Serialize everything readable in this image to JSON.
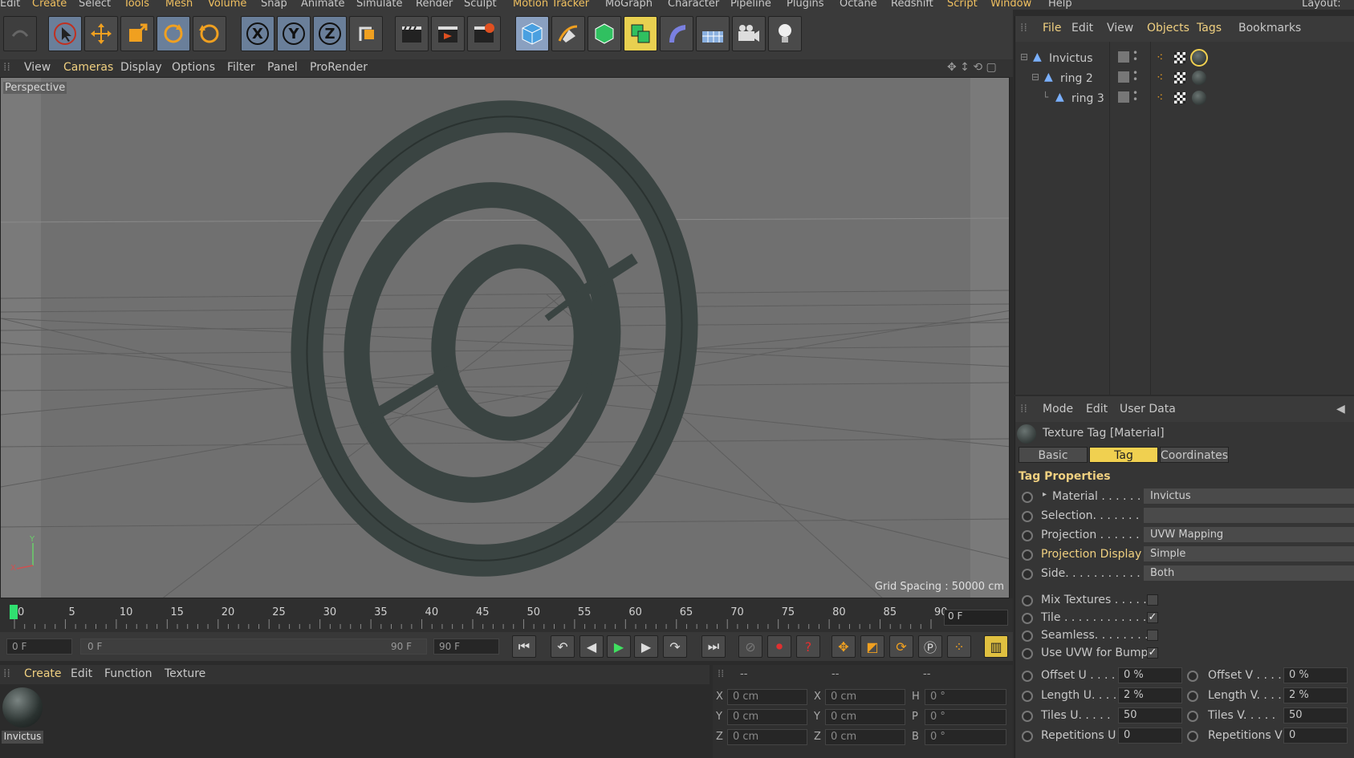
{
  "menubar": {
    "items": [
      "Edit",
      "Create",
      "Select",
      "Tools",
      "Mesh",
      "Volume",
      "Snap",
      "Animate",
      "Simulate",
      "Render",
      "Sculpt",
      "Motion Tracker",
      "MoGraph",
      "Character",
      "Pipeline",
      "Plugins",
      "Octane",
      "Redshift",
      "Script",
      "Window",
      "Help"
    ],
    "layout_label": "Layout:"
  },
  "viewport": {
    "menu": [
      "View",
      "Cameras",
      "Display",
      "Options",
      "Filter",
      "Panel",
      "ProRender"
    ],
    "camera_label": "Perspective",
    "grid_spacing": "Grid Spacing : 50000 cm",
    "bg_color": "#6e6e6e",
    "ring_color": "#3a4442"
  },
  "timeline": {
    "ticks": [
      "0",
      "5",
      "10",
      "15",
      "20",
      "25",
      "30",
      "35",
      "40",
      "45",
      "50",
      "55",
      "60",
      "65",
      "70",
      "75",
      "80",
      "85",
      "90"
    ],
    "end_frame": "0 F",
    "current_frame": 0
  },
  "transport": {
    "start_field": "0 F",
    "range_start": "0 F",
    "range_end": "90 F",
    "end_field": "90 F"
  },
  "material_manager": {
    "menu": [
      "Create",
      "Edit",
      "Function",
      "Texture"
    ],
    "materials": [
      {
        "name": "Invictus"
      }
    ]
  },
  "coordinates": {
    "header": [
      "--",
      "--",
      "--"
    ],
    "rows": [
      {
        "axis": "X",
        "pos": "0 cm",
        "axis2": "X",
        "size": "0 cm",
        "rot_label": "H",
        "rot": "0 °"
      },
      {
        "axis": "Y",
        "pos": "0 cm",
        "axis2": "Y",
        "size": "0 cm",
        "rot_label": "P",
        "rot": "0 °"
      },
      {
        "axis": "Z",
        "pos": "0 cm",
        "axis2": "Z",
        "size": "0 cm",
        "rot_label": "B",
        "rot": "0 °"
      }
    ]
  },
  "object_manager": {
    "menu": [
      "File",
      "Edit",
      "View",
      "Objects",
      "Tags",
      "Bookmarks"
    ],
    "objects": [
      {
        "name": "Invictus",
        "depth": 0
      },
      {
        "name": "ring 2",
        "depth": 1
      },
      {
        "name": "ring 3",
        "depth": 2
      }
    ]
  },
  "attributes": {
    "menu": [
      "Mode",
      "Edit",
      "User Data"
    ],
    "title": "Texture Tag [Material]",
    "tabs": [
      "Basic",
      "Tag",
      "Coordinates"
    ],
    "active_tab": "Tag",
    "section": "Tag Properties",
    "props": [
      {
        "label": "Material . . . . . . . . .",
        "value": "Invictus"
      },
      {
        "label": "Selection. . . . . . . . .",
        "value": ""
      },
      {
        "label": "Projection . . . . . . . .",
        "value": "UVW Mapping"
      },
      {
        "label": "Projection Display",
        "value": "Simple"
      },
      {
        "label": "Side. . . . . . . . . . . .",
        "value": "Both"
      }
    ],
    "checks": [
      {
        "label": "Mix Textures . . . . .",
        "checked": false
      },
      {
        "label": "Tile . . . . . . . . . . . .",
        "checked": true
      },
      {
        "label": "Seamless. . . . . . . .",
        "checked": false
      },
      {
        "label": "Use UVW for Bump",
        "checked": true
      }
    ],
    "check_marks": {
      "on": "✓",
      "off": ""
    },
    "numeric": [
      {
        "l1": "Offset U . . . .",
        "v1": "0 %",
        "l2": "Offset V . . . .",
        "v2": "0 %"
      },
      {
        "l1": "Length U. . . .",
        "v1": "2 %",
        "l2": "Length V. . . .",
        "v2": "2 %"
      },
      {
        "l1": "Tiles U. . . . .",
        "v1": "50",
        "l2": "Tiles V. . . . .",
        "v2": "50"
      },
      {
        "l1": "Repetitions U",
        "v1": "0",
        "l2": "Repetitions V",
        "v2": "0"
      }
    ]
  }
}
